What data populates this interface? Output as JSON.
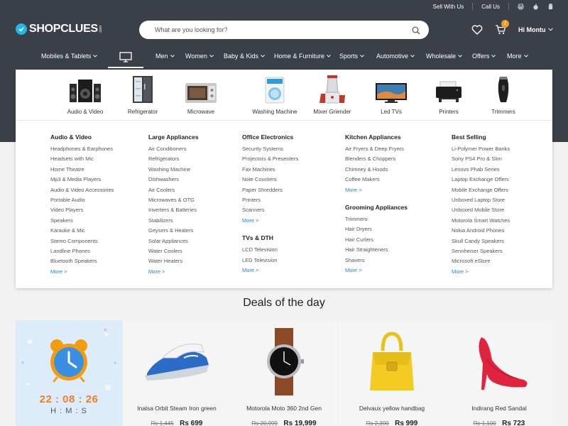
{
  "topbar": {
    "sell_with_us": "Sell With Us",
    "call_us": "Call Us"
  },
  "brand": {
    "logo_text": "SHOPCLUES",
    "logo_suffix": ".com",
    "accent": "#1fb9e8"
  },
  "search": {
    "placeholder": "What are you looking for?"
  },
  "header": {
    "cart_count": "2",
    "user_greeting": "Hi Montu"
  },
  "nav": {
    "items": [
      "Mobiles & Tablets",
      "Men",
      "Women",
      "Baby & Kids",
      "Home & Furniture",
      "Sports",
      "Automotive",
      "Wholesale",
      "Offers",
      "More"
    ],
    "active_icon": "monitor-icon"
  },
  "categories": [
    {
      "label": "Audio & Video",
      "icon": "speaker-system-icon"
    },
    {
      "label": "Refrigerator",
      "icon": "refrigerator-icon"
    },
    {
      "label": "Microwave",
      "icon": "microwave-icon"
    },
    {
      "label": "Washing Machine",
      "icon": "washing-machine-icon"
    },
    {
      "label": "Mixer Griender",
      "icon": "mixer-grinder-icon"
    },
    {
      "label": "Led TVs",
      "icon": "led-tv-icon"
    },
    {
      "label": "Printers",
      "icon": "printer-icon"
    },
    {
      "label": "Trimmers",
      "icon": "trimmer-icon"
    }
  ],
  "mega": {
    "more_label": "More >",
    "columns": [
      {
        "sections": [
          {
            "title": "Audio & Video",
            "items": [
              "Headphones & Earphones",
              "Headsets with Mic",
              "Home Theatre",
              "Mp3 & Media Players",
              "Audio & Video Accessories",
              "Portable Audio",
              "Video Players",
              "Speakers",
              "Karaoke & Mic",
              "Stereo Components",
              "Landline Phones",
              "Bluetooth Speakers"
            ]
          }
        ]
      },
      {
        "sections": [
          {
            "title": "Large Appliances",
            "items": [
              "Air Conditioners",
              "Refrigerators",
              "Washing Machine",
              "Dishwashers",
              "Air Coolers",
              "Microwaves & OTG",
              "Inverters & Batteries",
              "Stabilizers",
              "Geysers & Heaters",
              "Solar Appliances",
              "Water Coolers",
              "Water Heaters"
            ]
          }
        ]
      },
      {
        "sections": [
          {
            "title": "Office Electronics",
            "items": [
              "Security Systems",
              "Projectors & Presenters",
              "Fax Machines",
              "Note Counters",
              "Paper Shredders",
              "Printers",
              "Scanners"
            ]
          },
          {
            "title": "TVs & DTH",
            "items": [
              "LCD Television",
              "LED Television"
            ]
          }
        ]
      },
      {
        "sections": [
          {
            "title": "Kitchen Appliances",
            "items": [
              "Air Fryers & Deep Fryers",
              "Blenders & Choppers",
              "Chimney & Hoods",
              "Coffee Makers"
            ]
          },
          {
            "title": "Grooming Appliances",
            "items": [
              "Trimmers",
              "Hair Dryers",
              "Hair Curlers",
              "Hair Straighteners",
              "Shavers"
            ]
          }
        ]
      },
      {
        "sections": [
          {
            "title": "Best Selling",
            "items": [
              "Li-Polymer Power Banks",
              "Sony PS4 Pro & Slim",
              "Lenovo Phab Series",
              "Laptop Exchange Offers",
              "Mobile Exchange Offers",
              "Unboxed Laptop Store",
              "Unboxed Mobile Store",
              "Motorola Smart Watches",
              "Nokia Android Phones",
              "Skull Candy Speakers",
              "Sennheiser Speakers",
              "Microsoft eStore"
            ]
          }
        ]
      }
    ]
  },
  "deals": {
    "title": "Deals of the day",
    "timer": {
      "hours": "22",
      "minutes": "08",
      "seconds": "26",
      "sep": ":",
      "labels": "H : M : S",
      "accent": "#f07e26"
    },
    "products": [
      {
        "name": "Inalsa Orbit Steam Iron green",
        "old_price": "Rs 1,445",
        "new_price": "Rs 699",
        "icon": "steam-iron-icon"
      },
      {
        "name": "Motorola Moto 360 2nd Gen",
        "old_price": "Rs 20,999",
        "new_price": "Rs 19,999",
        "icon": "smartwatch-icon"
      },
      {
        "name": "Delvaux yellow handbag",
        "old_price": "Rs 2,390",
        "new_price": "Rs 999",
        "icon": "handbag-icon"
      },
      {
        "name": "Indirang Red Sandal",
        "old_price": "Rs 1,100",
        "new_price": "Rs 723",
        "icon": "high-heel-icon"
      }
    ]
  }
}
